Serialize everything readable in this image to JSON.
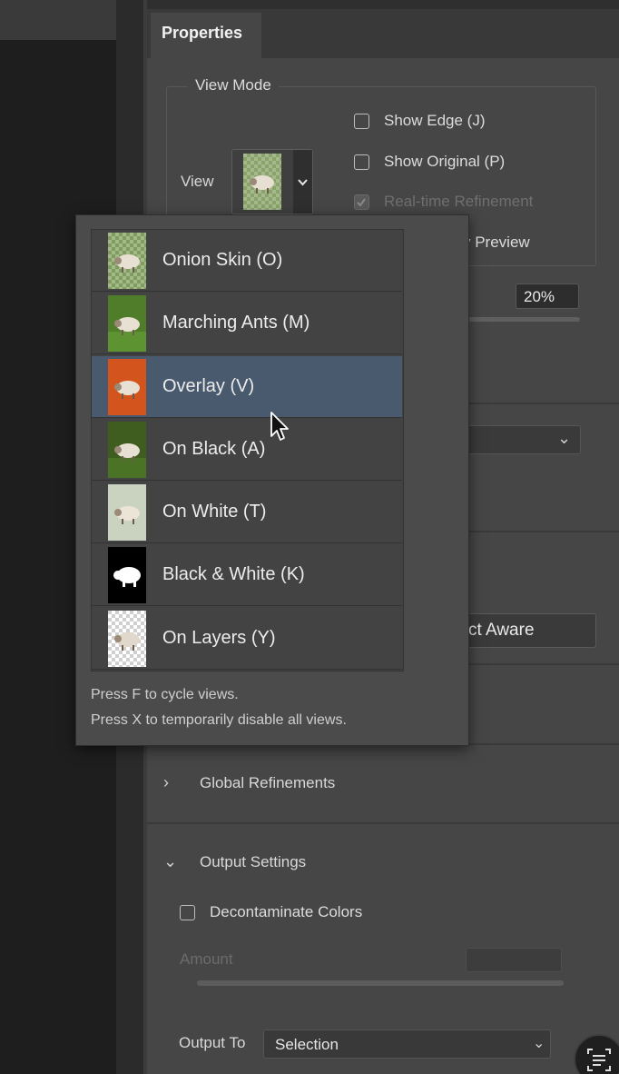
{
  "panel": {
    "tab_title": "Properties"
  },
  "view_mode": {
    "group_title": "View Mode",
    "view_label": "View",
    "thumbnail_icon": "sheep-onion-skin-thumbnail",
    "options": {
      "show_edge": "Show Edge (J)",
      "show_original": "Show Original (P)",
      "realtime_refinement": "Real-time Refinement",
      "hq_preview_partial": "y Preview"
    },
    "percent_value": "20%"
  },
  "popup": {
    "items": [
      {
        "label": "Onion Skin (O)",
        "thumb": "onion-skin"
      },
      {
        "label": "Marching Ants (M)",
        "thumb": "marching-ants"
      },
      {
        "label": "Overlay (V)",
        "thumb": "overlay",
        "selected": true
      },
      {
        "label": "On Black (A)",
        "thumb": "on-black"
      },
      {
        "label": "On White (T)",
        "thumb": "on-white"
      },
      {
        "label": "Black & White (K)",
        "thumb": "black-and-white"
      },
      {
        "label": "On Layers (Y)",
        "thumb": "on-layers"
      }
    ],
    "footer_line_1": "Press F to cycle views.",
    "footer_line_2": "Press X to temporarily disable all views."
  },
  "edge_detection": {
    "aware_button_partial": "ct Aware"
  },
  "sections": {
    "global_refinements": "Global Refinements",
    "output_settings": "Output Settings"
  },
  "output": {
    "decontaminate_label": "Decontaminate Colors",
    "amount_label": "Amount",
    "output_to_label": "Output To",
    "output_to_value": "Selection"
  },
  "colors": {
    "panel_bg": "#464646",
    "selected_row": "#49596e",
    "overlay_red": "#d4541e"
  }
}
